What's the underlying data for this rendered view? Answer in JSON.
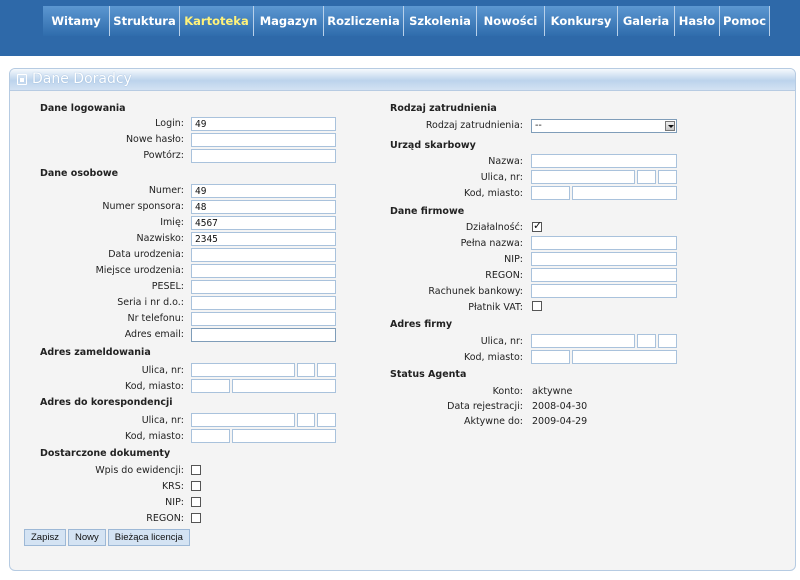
{
  "nav": {
    "items": [
      {
        "label": "Witamy"
      },
      {
        "label": "Struktura"
      },
      {
        "label": "Kartoteka"
      },
      {
        "label": "Magazyn"
      },
      {
        "label": "Rozliczenia"
      },
      {
        "label": "Szkolenia"
      },
      {
        "label": "Nowości"
      },
      {
        "label": "Konkursy"
      },
      {
        "label": "Galeria"
      },
      {
        "label": "Hasło"
      },
      {
        "label": "Pomoc"
      }
    ],
    "active": "Kartoteka"
  },
  "panel": {
    "title": "Dane Doradcy",
    "title_icon": "window-icon"
  },
  "left": {
    "logowanie": {
      "title": "Dane logowania",
      "login_label": "Login:",
      "login_value": "49",
      "nowe_haslo_label": "Nowe hasło:",
      "nowe_haslo_value": "",
      "powtorz_label": "Powtórz:",
      "powtorz_value": ""
    },
    "osobowe": {
      "title": "Dane osobowe",
      "numer_label": "Numer:",
      "numer_value": "49",
      "sponsor_label": "Numer sponsora:",
      "sponsor_value": "48",
      "imie_label": "Imię:",
      "imie_value": "4567",
      "nazwisko_label": "Nazwisko:",
      "nazwisko_value": "2345",
      "data_ur_label": "Data urodzenia:",
      "data_ur_value": "",
      "miejsce_ur_label": "Miejsce urodzenia:",
      "miejsce_ur_value": "",
      "pesel_label": "PESEL:",
      "pesel_value": "",
      "seria_label": "Seria i nr d.o.:",
      "seria_value": "",
      "telefon_label": "Nr telefonu:",
      "telefon_value": "",
      "email_label": "Adres email:",
      "email_value": ""
    },
    "zameldowanie": {
      "title": "Adres zameldowania",
      "ulica_label": "Ulica, nr:",
      "kod_label": "Kod, miasto:"
    },
    "korespondencja": {
      "title": "Adres do korespondencji",
      "ulica_label": "Ulica, nr:",
      "kod_label": "Kod, miasto:"
    },
    "dokumenty": {
      "title": "Dostarczone dokumenty",
      "wpis_label": "Wpis do ewidencji:",
      "wpis_checked": false,
      "krs_label": "KRS:",
      "krs_checked": false,
      "nip_label": "NIP:",
      "nip_checked": false,
      "regon_label": "REGON:",
      "regon_checked": false
    }
  },
  "right": {
    "zatrudnienie": {
      "title": "Rodzaj zatrudnienia",
      "label": "Rodzaj zatrudnienia:",
      "selected": "--"
    },
    "skarbowy": {
      "title": "Urząd skarbowy",
      "nazwa_label": "Nazwa:",
      "ulica_label": "Ulica, nr:",
      "kod_label": "Kod, miasto:"
    },
    "firmowe": {
      "title": "Dane firmowe",
      "dzialalnosc_label": "Działalność:",
      "dzialalnosc_checked": true,
      "pelna_nazwa_label": "Pełna nazwa:",
      "nip_label": "NIP:",
      "regon_label": "REGON:",
      "rachunek_label": "Rachunek bankowy:",
      "vat_label": "Płatnik VAT:",
      "vat_checked": false
    },
    "adres_firmy": {
      "title": "Adres firmy",
      "ulica_label": "Ulica, nr:",
      "kod_label": "Kod, miasto:"
    },
    "status": {
      "title": "Status Agenta",
      "konto_label": "Konto:",
      "konto_value": "aktywne",
      "data_rej_label": "Data rejestracji:",
      "data_rej_value": "2008-04-30",
      "aktywne_label": "Aktywne do:",
      "aktywne_value": "2009-04-29"
    }
  },
  "buttons": {
    "zapisz": "Zapisz",
    "nowy": "Nowy",
    "licencja": "Bieżąca licencja"
  },
  "colors": {
    "topbar": "#2e69a9",
    "nav_active_text": "#fff27a",
    "panel_bg": "#f4f4f4",
    "field_border": "#a9c2dc"
  }
}
